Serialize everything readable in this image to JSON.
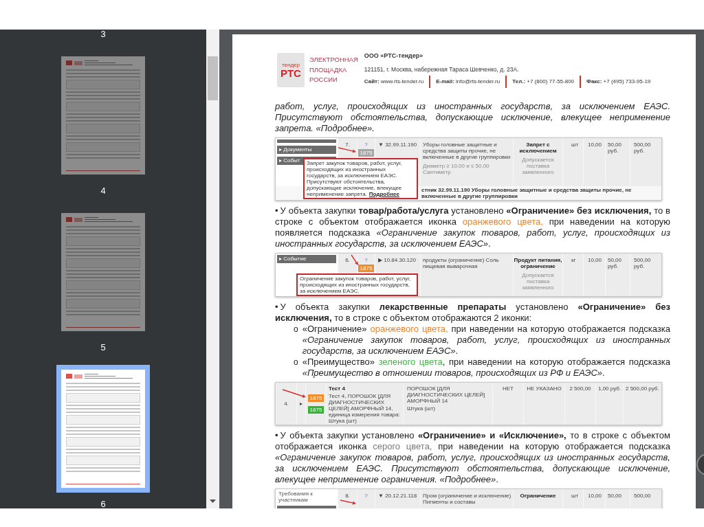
{
  "sidebar": {
    "top_label": "3",
    "pages": [
      {
        "label": "4",
        "selected": false
      },
      {
        "label": "5",
        "selected": false
      },
      {
        "label": "6",
        "selected": true
      }
    ]
  },
  "document": {
    "header": {
      "logo": {
        "caption": "тендер",
        "mark": "РТС"
      },
      "platform_name": "ЭЛЕКТРОННАЯ ПЛОЩАДКА РОССИИ",
      "company": "ООО «РТС-тендер»",
      "address": "121151, г. Москва, набережная Тараса Шевченко, д. 23А.",
      "contacts": [
        "**Сайт:** www.rts-tender.ru",
        "**E-mail:** info@rts-tender.ru",
        "**Тел.:** +7 (800) 77-55-800",
        "**Факс:** +7 (495) 733-95-19"
      ]
    },
    "blocks": [
      {
        "kind": "paragraph",
        "runs": [
          {
            "kind": "italic",
            "text": "работ, услуг, происходящих из иностранных государств, за исключением ЕАЭС. Присутствуют обстоятельства, допускающие исключение, влекущее неприменение запрета. «Подробнее»."
          }
        ]
      },
      {
        "kind": "screenshot",
        "side": [
          {
            "kind": "bar"
          },
          {
            "kind": "tab",
            "label": "▸ Документы"
          },
          {
            "kind": "tab",
            "label": "▸ Событ"
          }
        ],
        "cells": [
          [
            {
              "kind": "plain",
              "text": "7."
            }
          ],
          [
            {
              "kind": "help",
              "text": "?"
            },
            {
              "kind": "badge",
              "text": "1875",
              "color": "#a6a6a6"
            }
          ],
          [
            {
              "kind": "plain",
              "text": "▼ 32.99.11.190"
            }
          ],
          [
            {
              "kind": "plain",
              "text": "Уборы головные защитные и средства защиты прочие, не включенные в другие группировки"
            },
            {
              "kind": "muted",
              "text": "Диаметр ≥ 10,00 и ≤ 50,00 Сантиметр"
            }
          ],
          [
            {
              "kind": "bold",
              "text": "Запрет с исключением"
            },
            {
              "kind": "muted",
              "text": "Допускается поставка заявленного"
            }
          ],
          [
            {
              "kind": "plain",
              "text": "шт"
            }
          ],
          [
            {
              "kind": "plain",
              "text": "10,00"
            }
          ],
          [
            {
              "kind": "plain",
              "text": "50,00 руб."
            }
          ],
          [
            {
              "kind": "plain",
              "text": "500,00 руб."
            }
          ]
        ],
        "footer": "стник 32.99.11.190 Уборы головные защитные и средства защиты прочие, не включенные в другие группировки",
        "tooltip": {
          "text": "Запрет закупок товаров, работ, услуг, происходящих из иностранных государств, за исключением ЕАЭС. Присутствуют обстоятельства, допускающие исключение, влекущее неприменение запрета.",
          "link": "Подробнее"
        }
      },
      {
        "kind": "bullet",
        "bullet": "•",
        "runs": [
          {
            "kind": "plain",
            "text": "У объекта закупки "
          },
          {
            "kind": "bold",
            "text": "товар/работа/услуга"
          },
          {
            "kind": "plain",
            "text": " установлено "
          },
          {
            "kind": "bold",
            "text": "«Ограничение» без исключения,"
          },
          {
            "kind": "plain",
            "text": " то в строке с объектом отображается иконка "
          },
          {
            "kind": "colored",
            "text": "оранжевого цвета,",
            "color": "#e8842c"
          },
          {
            "kind": "plain",
            "text": " при наведении на которую появляется подсказка "
          },
          {
            "kind": "italic",
            "text": "«Ограничение закупок товаров, работ, услуг, происходящих из иностранных государств, за исключением ЕАЭС»"
          },
          {
            "kind": "plain",
            "text": "."
          }
        ]
      },
      {
        "kind": "screenshot",
        "side": [
          {
            "kind": "tab",
            "label": "▸ Событие"
          }
        ],
        "cells": [
          [
            {
              "kind": "plain",
              "text": "6."
            }
          ],
          [
            {
              "kind": "help",
              "text": "?"
            },
            {
              "kind": "badge",
              "text": "1875",
              "color": "#f28c28"
            }
          ],
          [
            {
              "kind": "plain",
              "text": "▶ 10.84.30.120"
            }
          ],
          [
            {
              "kind": "plain",
              "text": "продукты (ограничение) Соль пищевая выварочная"
            }
          ],
          [
            {
              "kind": "bold",
              "text": "Продукт питания, ограничение"
            },
            {
              "kind": "muted",
              "text": "Допускается поставка заявленного"
            }
          ],
          [
            {
              "kind": "plain",
              "text": "кг"
            }
          ],
          [
            {
              "kind": "plain",
              "text": "10,00"
            }
          ],
          [
            {
              "kind": "plain",
              "text": "50,00 руб."
            }
          ],
          [
            {
              "kind": "plain",
              "text": "500,00 руб."
            }
          ]
        ],
        "tooltip": {
          "text": "Ограничение закупок товаров, работ, услуг, происходящих из иностранных государств, за исключением ЕАЭС."
        }
      },
      {
        "kind": "bullet",
        "bullet": "•",
        "runs": [
          {
            "kind": "plain",
            "text": "У объекта закупки "
          },
          {
            "kind": "bold",
            "text": "лекарственные препараты"
          },
          {
            "kind": "plain",
            "text": " установлено "
          },
          {
            "kind": "bold",
            "text": "«Ограничение» без исключения,"
          },
          {
            "kind": "plain",
            "text": " то в строке с объектом отображаются 2 иконки:"
          }
        ]
      },
      {
        "kind": "subitem",
        "marker": "o",
        "runs": [
          {
            "kind": "plain",
            "text": "«Ограничение» "
          },
          {
            "kind": "colored",
            "text": "оранжевого цвета,",
            "color": "#e8842c"
          },
          {
            "kind": "plain",
            "text": " при наведении на которую отображается подсказка "
          },
          {
            "kind": "italic",
            "text": "«Ограничение закупок товаров, работ, услуг, происходящих из иностранных государств, за исключением ЕАЭС»"
          },
          {
            "kind": "plain",
            "text": "."
          }
        ]
      },
      {
        "kind": "subitem",
        "marker": "o",
        "runs": [
          {
            "kind": "plain",
            "text": "«Преимущество» "
          },
          {
            "kind": "colored",
            "text": "зеленого цвета",
            "color": "#3cb83c"
          },
          {
            "kind": "plain",
            "text": ", при наведении на которую отображается подсказка "
          },
          {
            "kind": "italic",
            "text": "«Преимущество в отношении товаров, происходящих из РФ и ЕАЭС»"
          },
          {
            "kind": "plain",
            "text": "."
          }
        ]
      },
      {
        "kind": "screenshot",
        "cells": [
          [
            {
              "kind": "plain",
              "text": "4."
            }
          ],
          [
            {
              "kind": "plain",
              "text": "▸"
            }
          ],
          [
            {
              "kind": "badge",
              "text": "1875",
              "color": "#f28c28"
            },
            {
              "kind": "badge",
              "text": "1875",
              "color": "#2fb52f"
            }
          ],
          [
            {
              "kind": "bold",
              "text": "Тест 4"
            },
            {
              "kind": "plain",
              "text": "Тест 4, ПОРОШОК [ДЛЯ ДИАГНОСТИЧЕСКИХ ЦЕЛЕЙ] АМОРФНЫЙ 14, единица измерения товара: Штука (шт)"
            }
          ],
          [
            {
              "kind": "plain",
              "text": "ПОРОШОК [ДЛЯ ДИАГНОСТИЧЕСКИХ ЦЕЛЕЙ] АМОРФНЫЙ 14"
            },
            {
              "kind": "plain",
              "text": "Штука (шт)"
            }
          ],
          [
            {
              "kind": "plain",
              "text": "НЕТ"
            }
          ],
          [
            {
              "kind": "plain",
              "text": "НЕ УКАЗАНО"
            }
          ],
          [
            {
              "kind": "plain",
              "text": "2 500,00"
            }
          ],
          [
            {
              "kind": "plain",
              "text": "1,00 руб."
            }
          ],
          [
            {
              "kind": "plain",
              "text": "2 500,00 руб."
            }
          ]
        ]
      },
      {
        "kind": "bullet",
        "bullet": "•",
        "runs": [
          {
            "kind": "plain",
            "text": "У объекта закупки установлено "
          },
          {
            "kind": "bold",
            "text": "«Ограничение» и «Исключение»,"
          },
          {
            "kind": "plain",
            "text": " то в строке с объектом отображается иконка "
          },
          {
            "kind": "colored",
            "text": "серого цвета,",
            "color": "#7a7a7a"
          },
          {
            "kind": "plain",
            "text": " при наведении на которую отображается подсказка "
          },
          {
            "kind": "italic",
            "text": "«Ограничение закупок товаров, работ, услуг, происходящих из иностранных государств, за исключением ЕАЭС. Присутствуют обстоятельства, допускающие исключение, влекущее неприменение ограничения. «Подробнее»"
          },
          {
            "kind": "plain",
            "text": "."
          }
        ]
      },
      {
        "kind": "screenshot",
        "side": [
          {
            "kind": "label",
            "label": "Требования к участникам"
          },
          {
            "kind": "bar"
          }
        ],
        "cells": [
          [
            {
              "kind": "plain",
              "text": "8."
            }
          ],
          [
            {
              "kind": "help",
              "text": "?"
            }
          ],
          [
            {
              "kind": "plain",
              "text": "▼ 20.12.21.118"
            }
          ],
          [
            {
              "kind": "plain",
              "text": "Пром (ограничение и исключение) Пигменты и составы"
            }
          ],
          [
            {
              "kind": "bold",
              "text": "Ограничение"
            }
          ],
          [
            {
              "kind": "plain",
              "text": "шт"
            }
          ],
          [
            {
              "kind": "plain",
              "text": "10,00"
            }
          ],
          [
            {
              "kind": "plain",
              "text": "50,00"
            }
          ],
          [
            {
              "kind": "plain",
              "text": "500,00"
            }
          ]
        ]
      }
    ]
  }
}
